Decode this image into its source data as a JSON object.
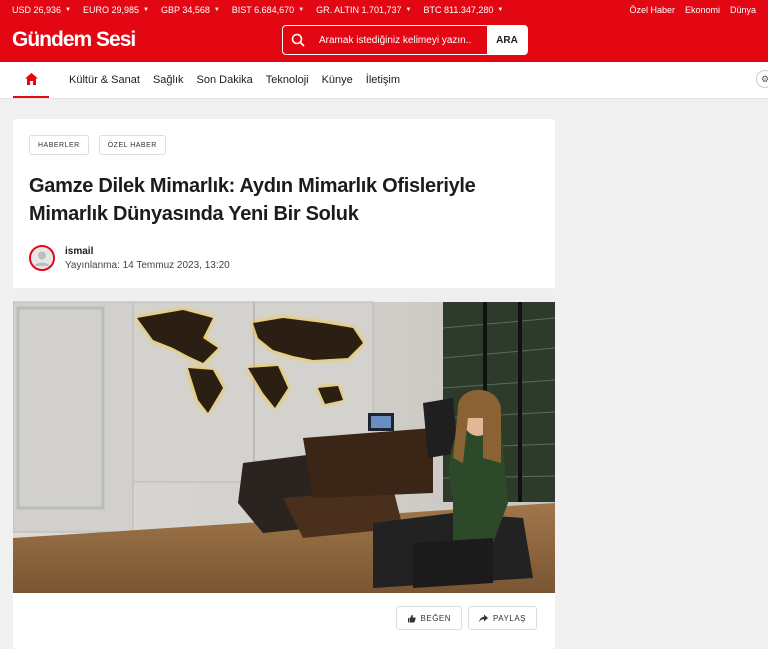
{
  "ticker": {
    "items": [
      {
        "label": "USD 26,936"
      },
      {
        "label": "EURO 29,985"
      },
      {
        "label": "GBP 34,568"
      },
      {
        "label": "BIST 6.684,670"
      },
      {
        "label": "GR. ALTIN 1.701,737"
      },
      {
        "label": "BTC 811.347,280"
      }
    ],
    "links": [
      "Özel Haber",
      "Ekonomi",
      "Dünya"
    ]
  },
  "header": {
    "logo": "Gündem Sesi",
    "search_placeholder": "Aramak istediğiniz kelimeyi yazın..",
    "search_button": "ARA"
  },
  "nav": {
    "home_icon": "home-icon",
    "items": [
      "Kültür & Sanat",
      "Sağlık",
      "Son Dakika",
      "Teknoloji",
      "Künye",
      "İletişim"
    ]
  },
  "article": {
    "tags": [
      "HABERLER",
      "ÖZEL HABER"
    ],
    "title": "Gamze Dilek Mimarlık: Aydın Mimarlık Ofisleriyle Mimarlık Dünyasında Yeni Bir Soluk",
    "author": "ismail",
    "published": "Yayınlanma: 14 Temmuz 2023, 13:20",
    "like_label": "BEĞEN",
    "share_label": "PAYLAŞ"
  },
  "colors": {
    "brand": "#e30613",
    "text": "#1c1c1c"
  }
}
